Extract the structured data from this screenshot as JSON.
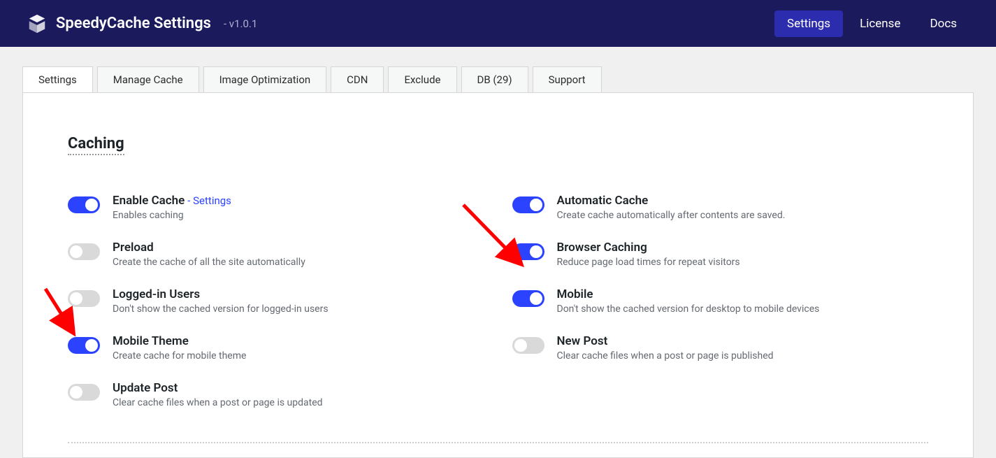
{
  "header": {
    "title": "SpeedyCache Settings",
    "version": "- v1.0.1",
    "nav": [
      {
        "label": "Settings",
        "active": true
      },
      {
        "label": "License",
        "active": false
      },
      {
        "label": "Docs",
        "active": false
      }
    ]
  },
  "tabs": [
    {
      "label": "Settings",
      "active": true
    },
    {
      "label": "Manage Cache",
      "active": false
    },
    {
      "label": "Image Optimization",
      "active": false
    },
    {
      "label": "CDN",
      "active": false
    },
    {
      "label": "Exclude",
      "active": false
    },
    {
      "label": "DB (29)",
      "active": false
    },
    {
      "label": "Support",
      "active": false
    }
  ],
  "section": {
    "title": "Caching"
  },
  "options": {
    "left": [
      {
        "title": "Enable Cache",
        "link": "- Settings",
        "desc": "Enables caching",
        "on": true
      },
      {
        "title": "Preload",
        "link": "",
        "desc": "Create the cache of all the site automatically",
        "on": false
      },
      {
        "title": "Logged-in Users",
        "link": "",
        "desc": "Don't show the cached version for logged-in users",
        "on": false
      },
      {
        "title": "Mobile Theme",
        "link": "",
        "desc": "Create cache for mobile theme",
        "on": true
      },
      {
        "title": "Update Post",
        "link": "",
        "desc": "Clear cache files when a post or page is updated",
        "on": false
      }
    ],
    "right": [
      {
        "title": "Automatic Cache",
        "link": "",
        "desc": "Create cache automatically after contents are saved.",
        "on": true
      },
      {
        "title": "Browser Caching",
        "link": "",
        "desc": "Reduce page load times for repeat visitors",
        "on": true
      },
      {
        "title": "Mobile",
        "link": "",
        "desc": "Don't show the cached version for desktop to mobile devices",
        "on": true
      },
      {
        "title": "New Post",
        "link": "",
        "desc": "Clear cache files when a post or page is published",
        "on": false
      }
    ]
  }
}
